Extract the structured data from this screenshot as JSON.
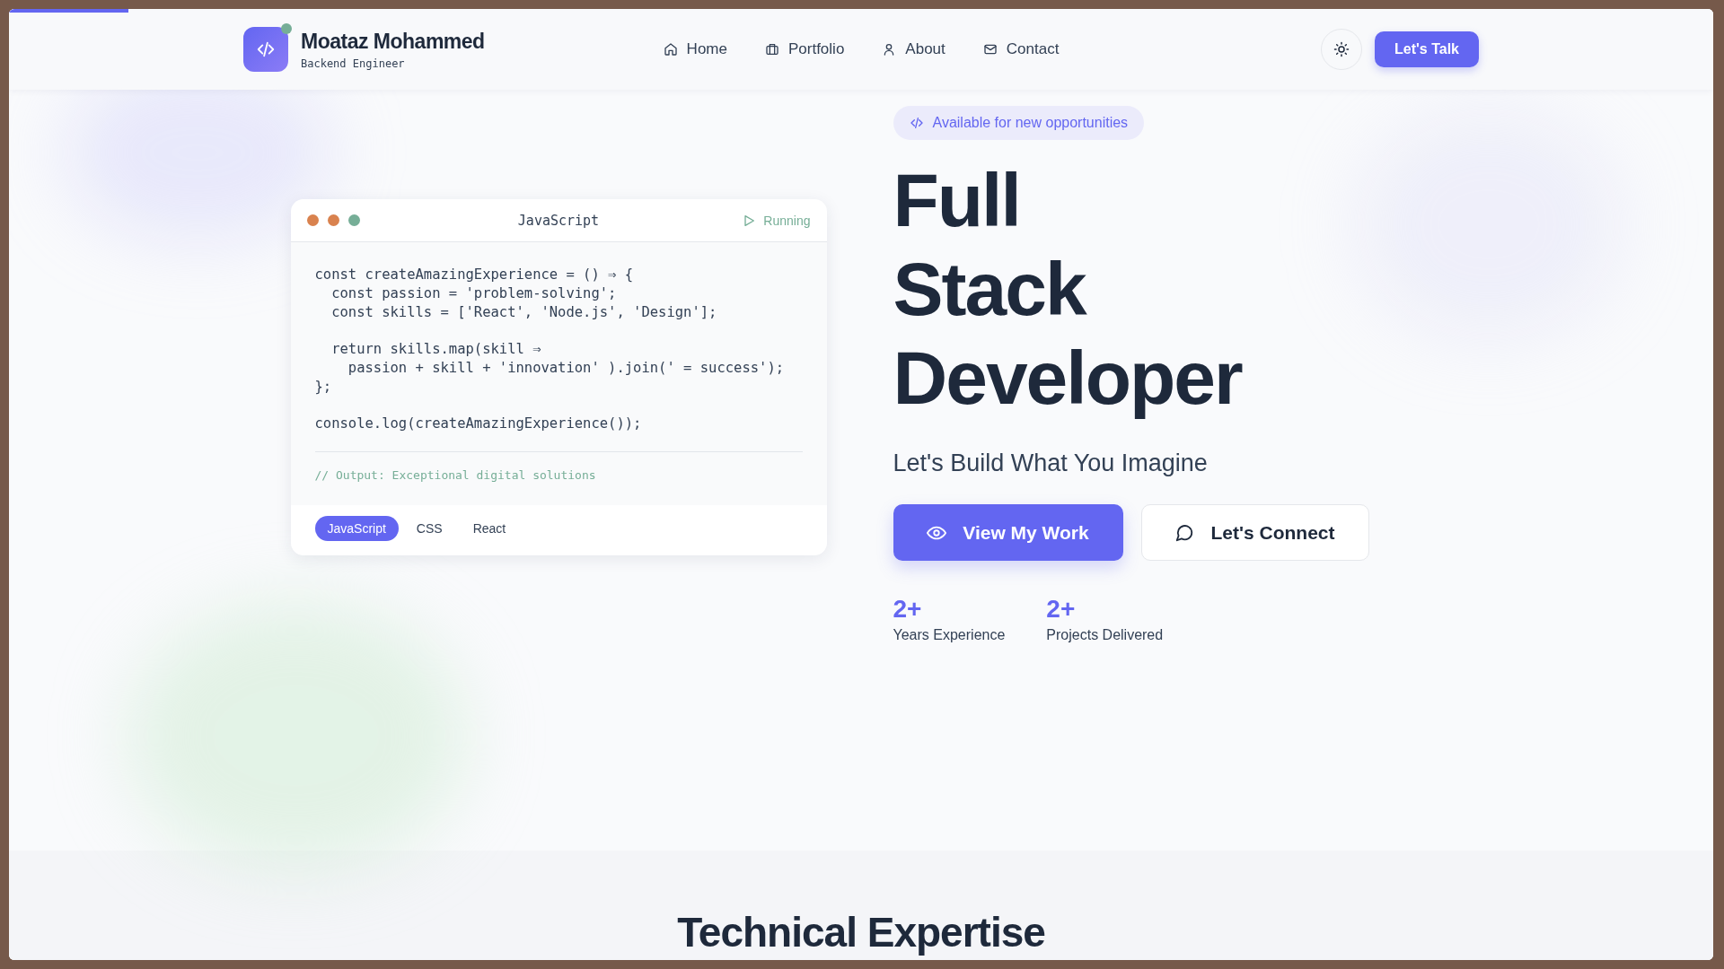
{
  "scroll_progress": {
    "level": 0.07
  },
  "header": {
    "logo": {
      "name": "Moataz Mohammed",
      "subtitle": "Backend Engineer",
      "online": true
    },
    "nav": [
      {
        "label": "Home",
        "selected": false
      },
      {
        "label": "Portfolio",
        "selected": false
      },
      {
        "label": "About",
        "selected": false
      },
      {
        "label": "Contact",
        "selected": false
      }
    ],
    "cta": "Let's Talk"
  },
  "code_window": {
    "dots": [
      {
        "color": "#d9824e"
      },
      {
        "color": "#d9824e"
      },
      {
        "color": "#76ae97"
      }
    ],
    "title": "JavaScript",
    "status": "Running",
    "code_blocks": [
      [
        "const createAmazingExperience = () ⇒ {",
        "  const passion = 'problem-solving';",
        "  const skills = ['React', 'Node.js', 'Design'];"
      ],
      [
        "  return skills.map(skill ⇒",
        "    passion + skill + 'innovation' ).join(' = success');",
        "};"
      ],
      [
        "console.log(createAmazingExperience());"
      ]
    ],
    "output": "// Output: Exceptional digital solutions",
    "tabs": [
      {
        "label": "JavaScript",
        "selected": true
      },
      {
        "label": "CSS",
        "selected": false
      },
      {
        "label": "React",
        "selected": false
      }
    ]
  },
  "hero": {
    "badge": "Available for new opportunities",
    "title_lines": [
      "Full",
      "Stack",
      "Developer"
    ],
    "tagline": "Let's Build What You Imagine",
    "buttons": [
      {
        "label": "View My Work",
        "kind": "primary"
      },
      {
        "label": "Let's Connect",
        "kind": "secondary"
      }
    ],
    "stats": [
      {
        "value": "2+",
        "label": "Years Experience"
      },
      {
        "value": "2+",
        "label": "Projects Delivered"
      }
    ]
  },
  "next_section": {
    "heading": "Technical Expertise"
  }
}
